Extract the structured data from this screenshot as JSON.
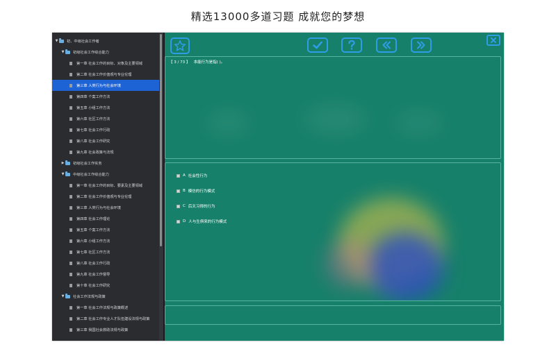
{
  "banner": {
    "title": "精选13000多道习题    成就您的梦想"
  },
  "colors": {
    "main_bg": "#17806a",
    "sidebar_bg": "#2b2c30",
    "selected": "#1e63d6",
    "accent": "#2f9ce6"
  },
  "sidebar": {
    "items": [
      {
        "label": "初、中级社会工作者",
        "icon": "folder-icon",
        "expanded": true,
        "selected": false
      },
      {
        "label": "初级社会工作综合能力",
        "icon": "folder-icon",
        "expanded": true,
        "selected": false
      },
      {
        "label": "第一章   社会工作的目标、对象及主要领域",
        "icon": "document-icon",
        "selected": false
      },
      {
        "label": "第二章   社会工作价值观与专业伦理",
        "icon": "document-icon",
        "selected": false
      },
      {
        "label": "第三章   人类行为与社会环境",
        "icon": "document-icon",
        "selected": true
      },
      {
        "label": "第四章   个案工作方法",
        "icon": "document-icon",
        "selected": false
      },
      {
        "label": "第五章   小组工作方法",
        "icon": "document-icon",
        "selected": false
      },
      {
        "label": "第六章   社区工作方法",
        "icon": "document-icon",
        "selected": false
      },
      {
        "label": "第七章   社会工作行政",
        "icon": "document-icon",
        "selected": false
      },
      {
        "label": "第八章   社会工作研究",
        "icon": "document-icon",
        "selected": false
      },
      {
        "label": "第九章   社会政策与法规",
        "icon": "document-icon",
        "selected": false
      },
      {
        "label": "初级社会工作实务",
        "icon": "folder-icon",
        "expanded": false,
        "selected": false
      },
      {
        "label": "中级社会工作综合能力",
        "icon": "folder-icon",
        "expanded": true,
        "selected": false
      },
      {
        "label": "第一章 社会工作的目标、要素及主要领域",
        "icon": "document-icon",
        "selected": false
      },
      {
        "label": "第二章 社会工作价值观与专业伦理",
        "icon": "document-icon",
        "selected": false
      },
      {
        "label": "第三章 人类行为与社会环境",
        "icon": "document-icon",
        "selected": false
      },
      {
        "label": "第四章 社会工作理论",
        "icon": "document-icon",
        "selected": false
      },
      {
        "label": "第五章 个案工作方法",
        "icon": "document-icon",
        "selected": false
      },
      {
        "label": "第六章 小组工作方法",
        "icon": "document-icon",
        "selected": false
      },
      {
        "label": "第七章 社区工作方法",
        "icon": "document-icon",
        "selected": false
      },
      {
        "label": "第八章 社会工作行政",
        "icon": "document-icon",
        "selected": false
      },
      {
        "label": "第九章 社会工作督导",
        "icon": "document-icon",
        "selected": false
      },
      {
        "label": "第十章 社会工作研究",
        "icon": "document-icon",
        "selected": false
      },
      {
        "label": "社会工作法规与政策",
        "icon": "folder-icon",
        "expanded": true,
        "selected": false
      },
      {
        "label": "第一章 社会工作法规与政策概述",
        "icon": "document-icon",
        "selected": false
      },
      {
        "label": "第二章 社会工作专业人才队伍建设法规与政策",
        "icon": "document-icon",
        "selected": false
      },
      {
        "label": "第三章  我国社会救助法规与政策",
        "icon": "document-icon",
        "selected": false
      }
    ]
  },
  "toolbar": {
    "favorite": {
      "icon": "star-icon"
    },
    "submit": {
      "icon": "check-icon"
    },
    "hint": {
      "icon": "question-icon"
    },
    "prev": {
      "icon": "double-left-icon"
    },
    "next": {
      "icon": "double-right-icon"
    },
    "close": {
      "icon": "close-icon"
    }
  },
  "question": {
    "progress": "【 3 / 73 】",
    "text": "本能行为是指(   )。"
  },
  "options": [
    {
      "letter": "A",
      "text": "社会性行为"
    },
    {
      "letter": "B",
      "text": "模仿的行为模式"
    },
    {
      "letter": "C",
      "text": "后天习得的行为"
    },
    {
      "letter": "D",
      "text": "人与生俱来的行为模式"
    }
  ]
}
